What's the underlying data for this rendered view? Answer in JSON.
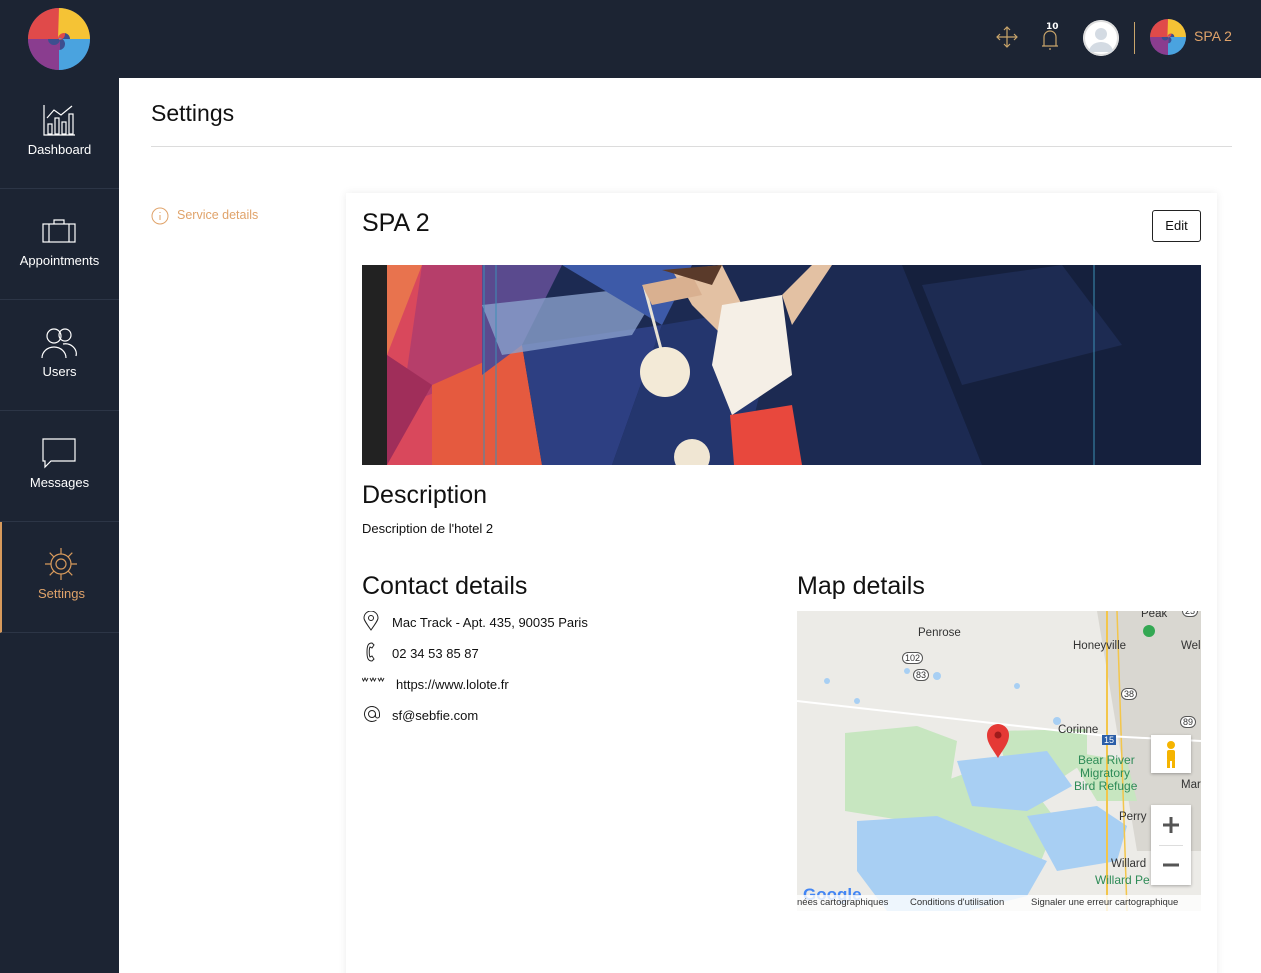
{
  "header": {
    "notification_count": "10",
    "org_name": "SPA 2",
    "icons": [
      "move-icon",
      "bell-icon",
      "user-avatar",
      "org-logo"
    ]
  },
  "sidebar": {
    "items": [
      {
        "label": "Dashboard",
        "icon": "chart-icon",
        "active": false
      },
      {
        "label": "Appointments",
        "icon": "briefcase-icon",
        "active": false
      },
      {
        "label": "Users",
        "icon": "users-icon",
        "active": false
      },
      {
        "label": "Messages",
        "icon": "chat-icon",
        "active": false
      },
      {
        "label": "Settings",
        "icon": "gear-icon",
        "active": true
      }
    ]
  },
  "page": {
    "title": "Settings"
  },
  "subnav": {
    "item_label": "Service details",
    "icon": "info-icon"
  },
  "card": {
    "title": "SPA 2",
    "edit_label": "Edit",
    "description_heading": "Description",
    "description_text": "Description de l'hotel 2",
    "contact_heading": "Contact details",
    "map_heading": "Map details",
    "contacts": [
      {
        "icon": "location-pin-icon",
        "text": "Mac Track - Apt. 435, 90035 Paris"
      },
      {
        "icon": "phone-icon",
        "text": "02 34 53 85 87"
      },
      {
        "icon": "www-icon",
        "text": "https://www.lolote.fr"
      },
      {
        "icon": "at-icon",
        "text": "sf@sebfie.com"
      }
    ]
  },
  "map": {
    "labels": {
      "penrose": "Penrose",
      "honeyville": "Honeyville",
      "corinne": "Corinne",
      "bear_river": "Bear River",
      "migratory": "Migratory",
      "bird_refuge": "Bird Refuge",
      "perry": "Perry",
      "willard": "Willard",
      "willard_pe": "Willard Pe",
      "peak": "Peak",
      "wel": "Wel",
      "mar": "Mar",
      "r102": "102",
      "r83": "83",
      "r38": "38",
      "r89": "89",
      "r15": "15",
      "r25": "25"
    },
    "footer": {
      "data": "nées cartographiques",
      "terms": "Conditions d'utilisation",
      "report": "Signaler une erreur cartographique"
    },
    "google": "Google"
  },
  "colors": {
    "sidebar_bg": "#1c2433",
    "accent": "#e0a36a",
    "active_nav": "#d79a5c"
  }
}
